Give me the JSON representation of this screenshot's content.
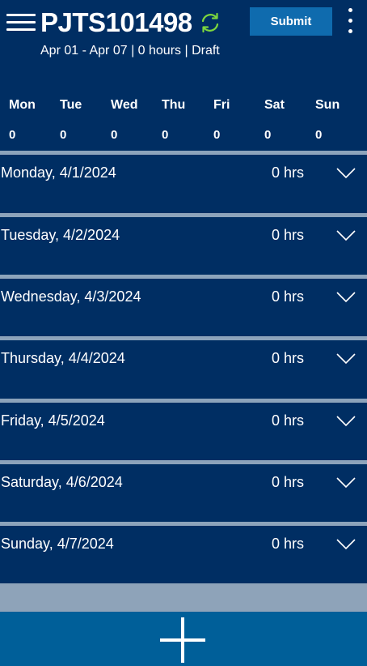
{
  "header": {
    "title": "PJTS101498",
    "subtitle": "Apr 01 - Apr 07 | 0 hours | Draft",
    "submit_label": "Submit",
    "sync_icon_color": "#7CD63E"
  },
  "week_summary": {
    "days": [
      {
        "name": "Mon",
        "total": "0"
      },
      {
        "name": "Tue",
        "total": "0"
      },
      {
        "name": "Wed",
        "total": "0"
      },
      {
        "name": "Thu",
        "total": "0"
      },
      {
        "name": "Fri",
        "total": "0"
      },
      {
        "name": "Sat",
        "total": "0"
      },
      {
        "name": "Sun",
        "total": "0"
      }
    ]
  },
  "day_entries": [
    {
      "date": "Monday, 4/1/2024",
      "hours": "0 hrs"
    },
    {
      "date": "Tuesday, 4/2/2024",
      "hours": "0 hrs"
    },
    {
      "date": "Wednesday, 4/3/2024",
      "hours": "0 hrs"
    },
    {
      "date": "Thursday, 4/4/2024",
      "hours": "0 hrs"
    },
    {
      "date": "Friday, 4/5/2024",
      "hours": "0 hrs"
    },
    {
      "date": "Saturday, 4/6/2024",
      "hours": "0 hrs"
    },
    {
      "date": "Sunday, 4/7/2024",
      "hours": "0 hrs"
    }
  ],
  "colors": {
    "background": "#002E63",
    "separator": "#8CA3BB",
    "button": "#0F6BAE",
    "add_bar": "#005F99",
    "accent_sync": "#7CD63E"
  },
  "icons": {
    "menu": "hamburger-menu-icon",
    "sync": "sync-icon",
    "more": "more-vertical-icon",
    "expand": "chevron-down-icon",
    "add": "plus-icon"
  }
}
